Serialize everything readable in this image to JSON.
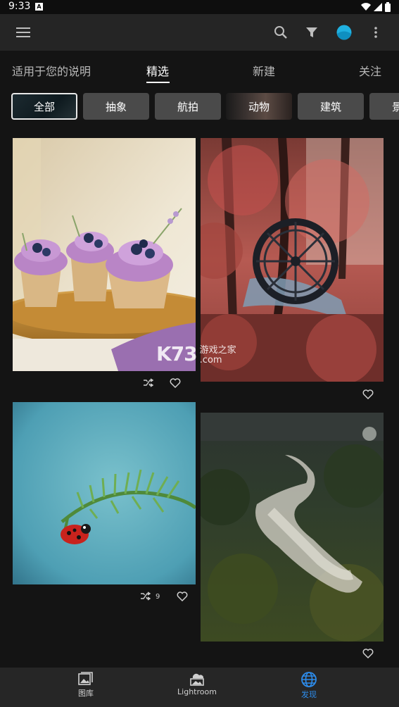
{
  "status": {
    "time": "9:33",
    "app_icon_letter": "A"
  },
  "app_bar": {
    "menu_icon": "hamburger-menu-icon",
    "search_icon": "search-icon",
    "filter_icon": "filter-funnel-icon",
    "avatar_color": "#1fb0e0",
    "more_icon": "more-vertical-icon"
  },
  "tabs": [
    {
      "label": "适用于您的说明",
      "active": false
    },
    {
      "label": "精选",
      "active": true
    },
    {
      "label": "新建",
      "active": false
    },
    {
      "label": "关注",
      "active": false
    }
  ],
  "chips": [
    {
      "label": "全部",
      "selected": true
    },
    {
      "label": "抽象",
      "selected": false
    },
    {
      "label": "航拍",
      "selected": false
    },
    {
      "label": "动物",
      "selected": false
    },
    {
      "label": "建筑",
      "selected": false
    },
    {
      "label": "景",
      "selected": false
    }
  ],
  "photos": [
    {
      "subject": "cupcakes",
      "remix": true,
      "remix_count": "",
      "like": true
    },
    {
      "subject": "water-wheel-red-forest",
      "remix": false,
      "remix_count": "",
      "like": true
    },
    {
      "subject": "ladybug-on-fern",
      "remix": true,
      "remix_count": "9",
      "like": true
    },
    {
      "subject": "misty-forest-aerial",
      "remix": false,
      "remix_count": "",
      "like": true
    }
  ],
  "watermark": {
    "brand": "K73",
    "cn": "游戏之家",
    "domain": ".com"
  },
  "bottom_nav": [
    {
      "label": "图库",
      "icon": "library-icon",
      "active": false
    },
    {
      "label": "Lightroom",
      "icon": "lightroom-cloud-icon",
      "active": false
    },
    {
      "label": "发现",
      "icon": "globe-discover-icon",
      "active": true
    }
  ],
  "colors": {
    "accent": "#2d8ceb",
    "background": "#141414",
    "surface": "#252525",
    "chip": "#4a4a4a"
  }
}
